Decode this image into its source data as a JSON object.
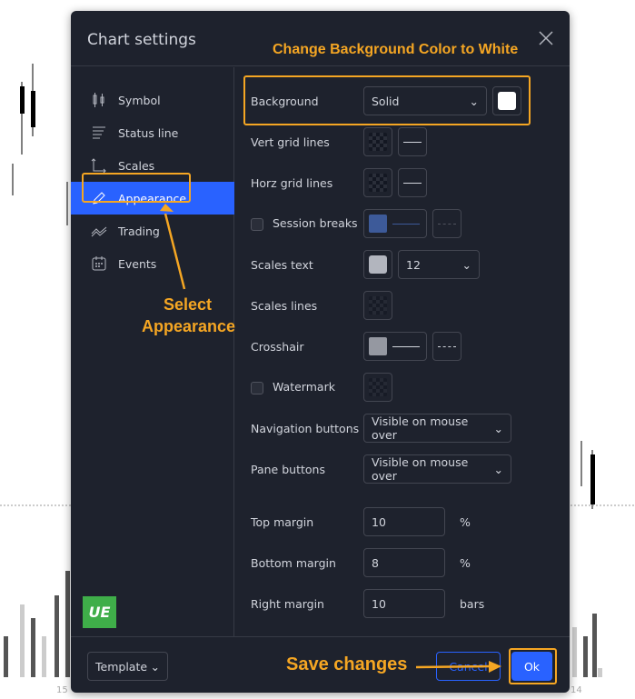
{
  "dialog": {
    "title": "Chart settings"
  },
  "sidebar": {
    "items": [
      {
        "label": "Symbol",
        "icon": "candles-icon"
      },
      {
        "label": "Status line",
        "icon": "status-line-icon"
      },
      {
        "label": "Scales",
        "icon": "scales-icon"
      },
      {
        "label": "Appearance",
        "icon": "pencil-icon",
        "active": true
      },
      {
        "label": "Trading",
        "icon": "trading-icon"
      },
      {
        "label": "Events",
        "icon": "calendar-icon"
      }
    ]
  },
  "appearance": {
    "background": {
      "label": "Background",
      "type": "Solid",
      "color": "#ffffff"
    },
    "vert_grid": {
      "label": "Vert grid lines"
    },
    "horz_grid": {
      "label": "Horz grid lines"
    },
    "session_breaks": {
      "label": "Session breaks",
      "checked": false,
      "color": "#3d5a99"
    },
    "scales_text": {
      "label": "Scales text",
      "color": "#b2b5be",
      "size": "12"
    },
    "scales_lines": {
      "label": "Scales lines"
    },
    "crosshair": {
      "label": "Crosshair",
      "color": "#9598a1"
    },
    "watermark": {
      "label": "Watermark",
      "checked": false
    },
    "nav_buttons": {
      "label": "Navigation buttons",
      "value": "Visible on mouse over"
    },
    "pane_buttons": {
      "label": "Pane buttons",
      "value": "Visible on mouse over"
    },
    "top_margin": {
      "label": "Top margin",
      "value": "10",
      "unit": "%"
    },
    "bottom_margin": {
      "label": "Bottom margin",
      "value": "8",
      "unit": "%"
    },
    "right_margin": {
      "label": "Right margin",
      "value": "10",
      "unit": "bars"
    }
  },
  "footer": {
    "template": "Template",
    "cancel": "Cancel",
    "ok": "Ok"
  },
  "annotations": {
    "bg": "Change Background Color to White",
    "select1": "Select",
    "select2": "Appearance",
    "save": "Save changes"
  },
  "chart_axis": {
    "labels": [
      "15",
      "14"
    ]
  },
  "colors": {
    "accent": "#2962ff",
    "annotation": "#f5a623",
    "dialog_bg": "#1e222d"
  }
}
